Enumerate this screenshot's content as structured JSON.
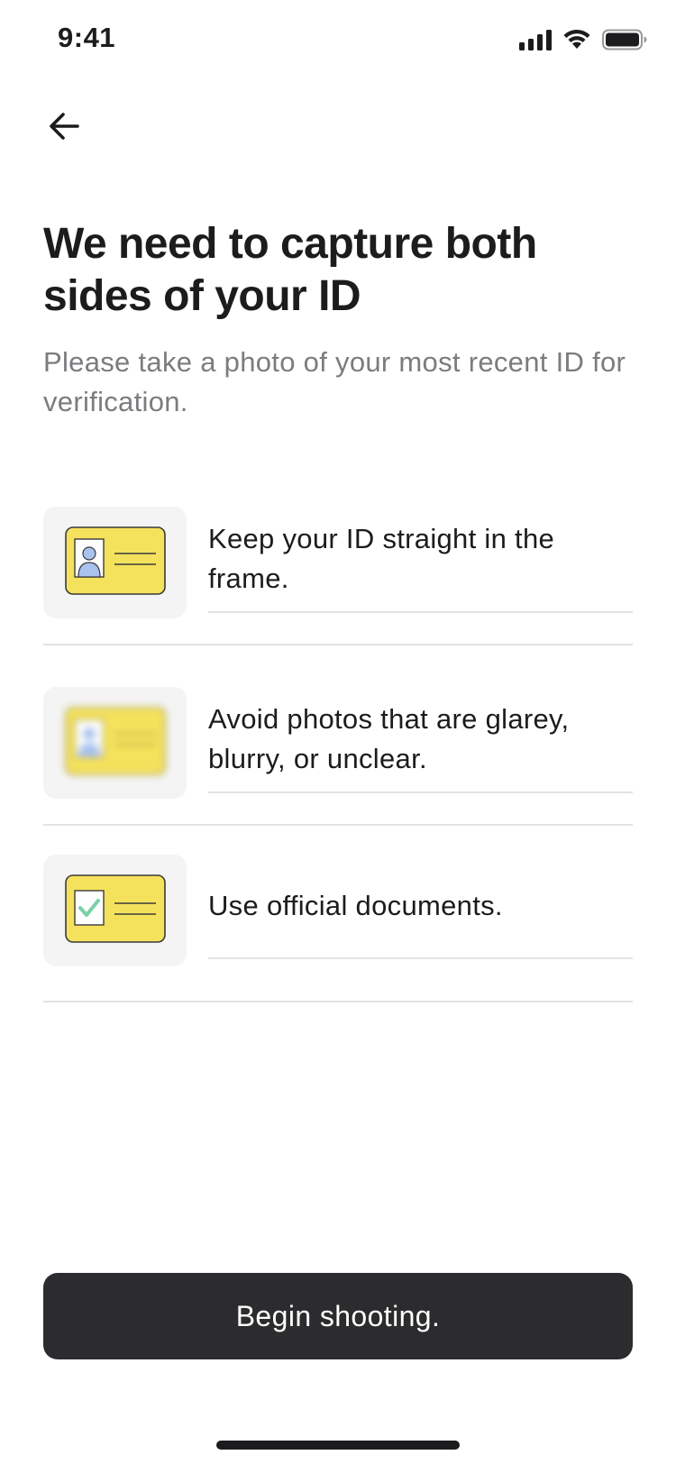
{
  "status_bar": {
    "time": "9:41",
    "icons": [
      "cellular-signal-icon",
      "wifi-icon",
      "battery-icon"
    ]
  },
  "header": {
    "back_icon": "arrow-left-icon"
  },
  "main": {
    "title": "We need to capture both sides of your ID",
    "subtitle": "Please take a photo of your most recent ID for verification."
  },
  "tips": [
    {
      "text": "Keep your ID straight in the frame.",
      "icon": "id-card-icon"
    },
    {
      "text": "Avoid photos that are glarey, blurry, or unclear.",
      "icon": "blurry-id-card-icon"
    },
    {
      "text": "Use official documents.",
      "icon": "verified-id-card-icon"
    }
  ],
  "footer": {
    "button_label": "Begin shooting."
  },
  "colors": {
    "card_yellow": "#F5E25C",
    "photo_blue": "#A9C2EE",
    "check_green": "#7BD1A9",
    "button_dark": "#2C2C2E",
    "icon_bg": "#F4F4F4"
  }
}
